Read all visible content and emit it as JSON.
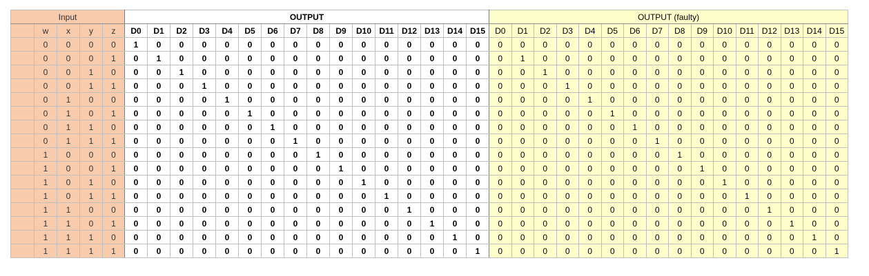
{
  "headers": {
    "input": "Input",
    "output": "OUTPUT",
    "faulty": "OUTPUT (faulty)"
  },
  "input_columns": [
    "",
    "w",
    "x",
    "y",
    "z"
  ],
  "output_columns": [
    "D0",
    "D1",
    "D2",
    "D3",
    "D4",
    "D5",
    "D6",
    "D7",
    "D8",
    "D9",
    "D10",
    "D11",
    "D12",
    "D13",
    "D14",
    "D15"
  ],
  "faulty_columns": [
    "D0",
    "D1",
    "D2",
    "D3",
    "D4",
    "D5",
    "D6",
    "D7",
    "D8",
    "D9",
    "D10",
    "D11",
    "D12",
    "D13",
    "D14",
    "D15"
  ],
  "rows": [
    {
      "inputs": [
        "0",
        "0",
        "0",
        "0"
      ],
      "output": [
        "1",
        "0",
        "0",
        "0",
        "0",
        "0",
        "0",
        "0",
        "0",
        "0",
        "0",
        "0",
        "0",
        "0",
        "0",
        "0"
      ],
      "faulty": [
        "0",
        "0",
        "0",
        "0",
        "0",
        "0",
        "0",
        "0",
        "0",
        "0",
        "0",
        "0",
        "0",
        "0",
        "0",
        "0"
      ]
    },
    {
      "inputs": [
        "0",
        "0",
        "0",
        "1"
      ],
      "output": [
        "0",
        "1",
        "0",
        "0",
        "0",
        "0",
        "0",
        "0",
        "0",
        "0",
        "0",
        "0",
        "0",
        "0",
        "0",
        "0"
      ],
      "faulty": [
        "0",
        "1",
        "0",
        "0",
        "0",
        "0",
        "0",
        "0",
        "0",
        "0",
        "0",
        "0",
        "0",
        "0",
        "0",
        "0"
      ]
    },
    {
      "inputs": [
        "0",
        "0",
        "1",
        "0"
      ],
      "output": [
        "0",
        "0",
        "1",
        "0",
        "0",
        "0",
        "0",
        "0",
        "0",
        "0",
        "0",
        "0",
        "0",
        "0",
        "0",
        "0"
      ],
      "faulty": [
        "0",
        "0",
        "1",
        "0",
        "0",
        "0",
        "0",
        "0",
        "0",
        "0",
        "0",
        "0",
        "0",
        "0",
        "0",
        "0"
      ]
    },
    {
      "inputs": [
        "0",
        "0",
        "1",
        "1"
      ],
      "output": [
        "0",
        "0",
        "0",
        "1",
        "0",
        "0",
        "0",
        "0",
        "0",
        "0",
        "0",
        "0",
        "0",
        "0",
        "0",
        "0"
      ],
      "faulty": [
        "0",
        "0",
        "0",
        "1",
        "0",
        "0",
        "0",
        "0",
        "0",
        "0",
        "0",
        "0",
        "0",
        "0",
        "0",
        "0"
      ]
    },
    {
      "inputs": [
        "0",
        "1",
        "0",
        "0"
      ],
      "output": [
        "0",
        "0",
        "0",
        "0",
        "1",
        "0",
        "0",
        "0",
        "0",
        "0",
        "0",
        "0",
        "0",
        "0",
        "0",
        "0"
      ],
      "faulty": [
        "0",
        "0",
        "0",
        "0",
        "1",
        "0",
        "0",
        "0",
        "0",
        "0",
        "0",
        "0",
        "0",
        "0",
        "0",
        "0"
      ]
    },
    {
      "inputs": [
        "0",
        "1",
        "0",
        "1"
      ],
      "output": [
        "0",
        "0",
        "0",
        "0",
        "0",
        "1",
        "0",
        "0",
        "0",
        "0",
        "0",
        "0",
        "0",
        "0",
        "0",
        "0"
      ],
      "faulty": [
        "0",
        "0",
        "0",
        "0",
        "0",
        "1",
        "0",
        "0",
        "0",
        "0",
        "0",
        "0",
        "0",
        "0",
        "0",
        "0"
      ]
    },
    {
      "inputs": [
        "0",
        "1",
        "1",
        "0"
      ],
      "output": [
        "0",
        "0",
        "0",
        "0",
        "0",
        "0",
        "1",
        "0",
        "0",
        "0",
        "0",
        "0",
        "0",
        "0",
        "0",
        "0"
      ],
      "faulty": [
        "0",
        "0",
        "0",
        "0",
        "0",
        "0",
        "1",
        "0",
        "0",
        "0",
        "0",
        "0",
        "0",
        "0",
        "0",
        "0"
      ]
    },
    {
      "inputs": [
        "0",
        "1",
        "1",
        "1"
      ],
      "output": [
        "0",
        "0",
        "0",
        "0",
        "0",
        "0",
        "0",
        "1",
        "0",
        "0",
        "0",
        "0",
        "0",
        "0",
        "0",
        "0"
      ],
      "faulty": [
        "0",
        "0",
        "0",
        "0",
        "0",
        "0",
        "0",
        "1",
        "0",
        "0",
        "0",
        "0",
        "0",
        "0",
        "0",
        "0"
      ]
    },
    {
      "inputs": [
        "1",
        "0",
        "0",
        "0"
      ],
      "output": [
        "0",
        "0",
        "0",
        "0",
        "0",
        "0",
        "0",
        "0",
        "1",
        "0",
        "0",
        "0",
        "0",
        "0",
        "0",
        "0"
      ],
      "faulty": [
        "0",
        "0",
        "0",
        "0",
        "0",
        "0",
        "0",
        "0",
        "1",
        "0",
        "0",
        "0",
        "0",
        "0",
        "0",
        "0"
      ]
    },
    {
      "inputs": [
        "1",
        "0",
        "0",
        "1"
      ],
      "output": [
        "0",
        "0",
        "0",
        "0",
        "0",
        "0",
        "0",
        "0",
        "0",
        "1",
        "0",
        "0",
        "0",
        "0",
        "0",
        "0"
      ],
      "faulty": [
        "0",
        "0",
        "0",
        "0",
        "0",
        "0",
        "0",
        "0",
        "0",
        "1",
        "0",
        "0",
        "0",
        "0",
        "0",
        "0"
      ]
    },
    {
      "inputs": [
        "1",
        "0",
        "1",
        "0"
      ],
      "output": [
        "0",
        "0",
        "0",
        "0",
        "0",
        "0",
        "0",
        "0",
        "0",
        "0",
        "1",
        "0",
        "0",
        "0",
        "0",
        "0"
      ],
      "faulty": [
        "0",
        "0",
        "0",
        "0",
        "0",
        "0",
        "0",
        "0",
        "0",
        "0",
        "1",
        "0",
        "0",
        "0",
        "0",
        "0"
      ]
    },
    {
      "inputs": [
        "1",
        "0",
        "1",
        "1"
      ],
      "output": [
        "0",
        "0",
        "0",
        "0",
        "0",
        "0",
        "0",
        "0",
        "0",
        "0",
        "0",
        "1",
        "0",
        "0",
        "0",
        "0"
      ],
      "faulty": [
        "0",
        "0",
        "0",
        "0",
        "0",
        "0",
        "0",
        "0",
        "0",
        "0",
        "0",
        "1",
        "0",
        "0",
        "0",
        "0"
      ]
    },
    {
      "inputs": [
        "1",
        "1",
        "0",
        "0"
      ],
      "output": [
        "0",
        "0",
        "0",
        "0",
        "0",
        "0",
        "0",
        "0",
        "0",
        "0",
        "0",
        "0",
        "1",
        "0",
        "0",
        "0"
      ],
      "faulty": [
        "0",
        "0",
        "0",
        "0",
        "0",
        "0",
        "0",
        "0",
        "0",
        "0",
        "0",
        "0",
        "1",
        "0",
        "0",
        "0"
      ]
    },
    {
      "inputs": [
        "1",
        "1",
        "0",
        "1"
      ],
      "output": [
        "0",
        "0",
        "0",
        "0",
        "0",
        "0",
        "0",
        "0",
        "0",
        "0",
        "0",
        "0",
        "0",
        "1",
        "0",
        "0"
      ],
      "faulty": [
        "0",
        "0",
        "0",
        "0",
        "0",
        "0",
        "0",
        "0",
        "0",
        "0",
        "0",
        "0",
        "0",
        "1",
        "0",
        "0"
      ]
    },
    {
      "inputs": [
        "1",
        "1",
        "1",
        "0"
      ],
      "output": [
        "0",
        "0",
        "0",
        "0",
        "0",
        "0",
        "0",
        "0",
        "0",
        "0",
        "0",
        "0",
        "0",
        "0",
        "1",
        "0"
      ],
      "faulty": [
        "0",
        "0",
        "0",
        "0",
        "0",
        "0",
        "0",
        "0",
        "0",
        "0",
        "0",
        "0",
        "0",
        "0",
        "1",
        "0"
      ]
    },
    {
      "inputs": [
        "1",
        "1",
        "1",
        "1"
      ],
      "output": [
        "0",
        "0",
        "0",
        "0",
        "0",
        "0",
        "0",
        "0",
        "0",
        "0",
        "0",
        "0",
        "0",
        "0",
        "0",
        "1"
      ],
      "faulty": [
        "0",
        "0",
        "0",
        "0",
        "0",
        "0",
        "0",
        "0",
        "0",
        "0",
        "0",
        "0",
        "0",
        "0",
        "0",
        "1"
      ]
    }
  ],
  "colors": {
    "input_fill": "#f8cbad",
    "output_fill": "#ffffff",
    "faulty_fill": "#ffffcc",
    "grid": "#bfbfbf"
  }
}
